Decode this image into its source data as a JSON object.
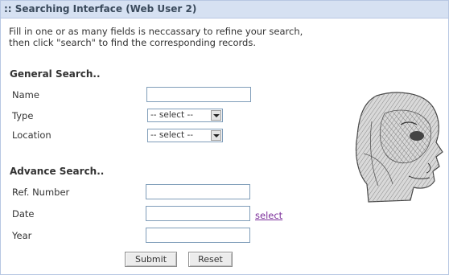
{
  "header": {
    "title": ":: Searching Interface (Web User 2)"
  },
  "intro": {
    "line1": "Fill in one or as many fields is neccassary to refine your search,",
    "line2": "then click \"search\" to find the corresponding records."
  },
  "general_search": {
    "title": "General Search..",
    "name_label": "Name",
    "name_value": "",
    "type_label": "Type",
    "type_selected": "-- select --",
    "location_label": "Location",
    "location_selected": "-- select --"
  },
  "advance_search": {
    "title": "Advance Search..",
    "ref_label": "Ref. Number",
    "ref_value": "",
    "date_label": "Date",
    "date_value": "",
    "date_link": "select",
    "year_label": "Year",
    "year_value": ""
  },
  "buttons": {
    "submit": "Submit",
    "reset": "Reset"
  },
  "icons": {
    "illustration": "head-skull-sketch-image",
    "dropdown": "chevron-down-icon"
  },
  "colors": {
    "title_bar": "#d6e1f2",
    "link": "#7b2e9a",
    "border": "#b7c7e2"
  }
}
